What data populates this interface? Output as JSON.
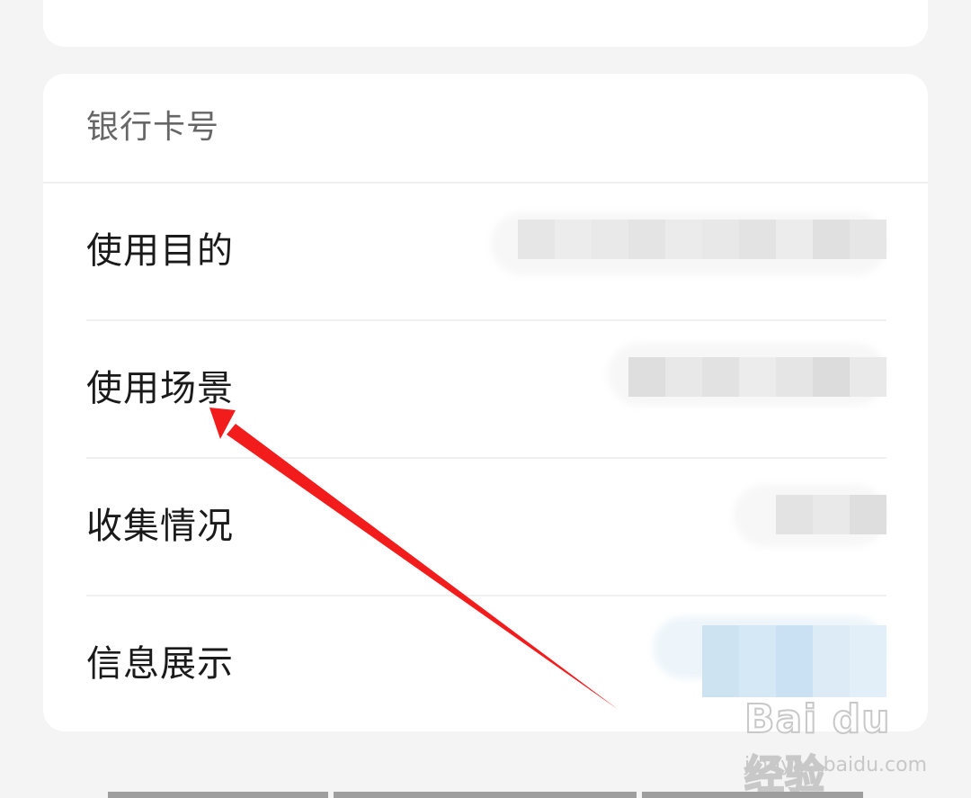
{
  "section": {
    "title": "银行卡号"
  },
  "rows": [
    {
      "label": "使用目的",
      "value_colors": [
        "#e6e6e6",
        "#ececec",
        "#e9e9e9",
        "#e4e4e4",
        "#ebebeb",
        "#e8e8e8",
        "#e3e3e3",
        "#ececec",
        "#e0e0e0",
        "#e6e6e6"
      ]
    },
    {
      "label": "使用场景",
      "value_colors": [
        "#dedede",
        "#e8e8e8",
        "#e2e2e2",
        "#ececec",
        "#e5e5e5",
        "#dcdcdc",
        "#e9e9e9"
      ]
    },
    {
      "label": "收集情况",
      "value_colors": [
        "#e3e3e3",
        "#e9e9e9",
        "#dedede"
      ]
    },
    {
      "label": "信息展示",
      "value_colors": [
        "#cde3f2",
        "#d4e8f5",
        "#c9e1f2",
        "#dcebf6",
        "#e2eff8"
      ]
    }
  ],
  "annotation": {
    "arrow_color": "#f21c1c",
    "target": "使用场景"
  },
  "watermark": {
    "logo": "Bai du 经验",
    "url": "jingyan.baidu.com"
  },
  "colors": {
    "background": "#f4f4f4",
    "card": "#ffffff",
    "label_text": "#1a1a1a",
    "title_text": "#666666",
    "divider": "#f0f0f0"
  }
}
